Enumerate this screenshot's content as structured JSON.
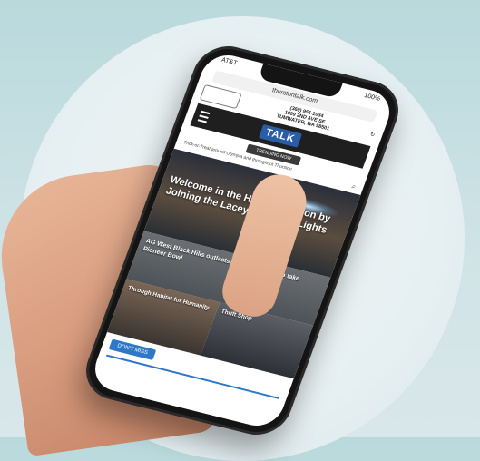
{
  "phone": {
    "status_left": "AT&T",
    "status_right": "100%",
    "url": "thurstontalk.com",
    "header": {
      "address_line1": "(360) 956-1034",
      "address_line2": "1009 2ND AVE SE",
      "address_line3": "TUMWATER, WA 98501",
      "brand_name": "TALK",
      "trending_label": "TRENDING NOW",
      "tagline": "Trick-or-Treat around Olympia and throughout Thurston"
    },
    "hero": {
      "title": "Welcome in the Holiday Season by Joining the Lacey Parade of Lights"
    },
    "second_story": {
      "title": "AG West Black Hills outlasts Tumwater 22-17 to take Pioneer Bowl"
    },
    "tiles": [
      {
        "title": "Through Habitat for Humanity"
      },
      {
        "title": "Thrift Shop"
      }
    ],
    "dont_miss_label": "DON'T MISS"
  },
  "icons": {
    "menu": "hamburger-menu-icon",
    "search": "search-icon",
    "refresh": "refresh-icon"
  }
}
